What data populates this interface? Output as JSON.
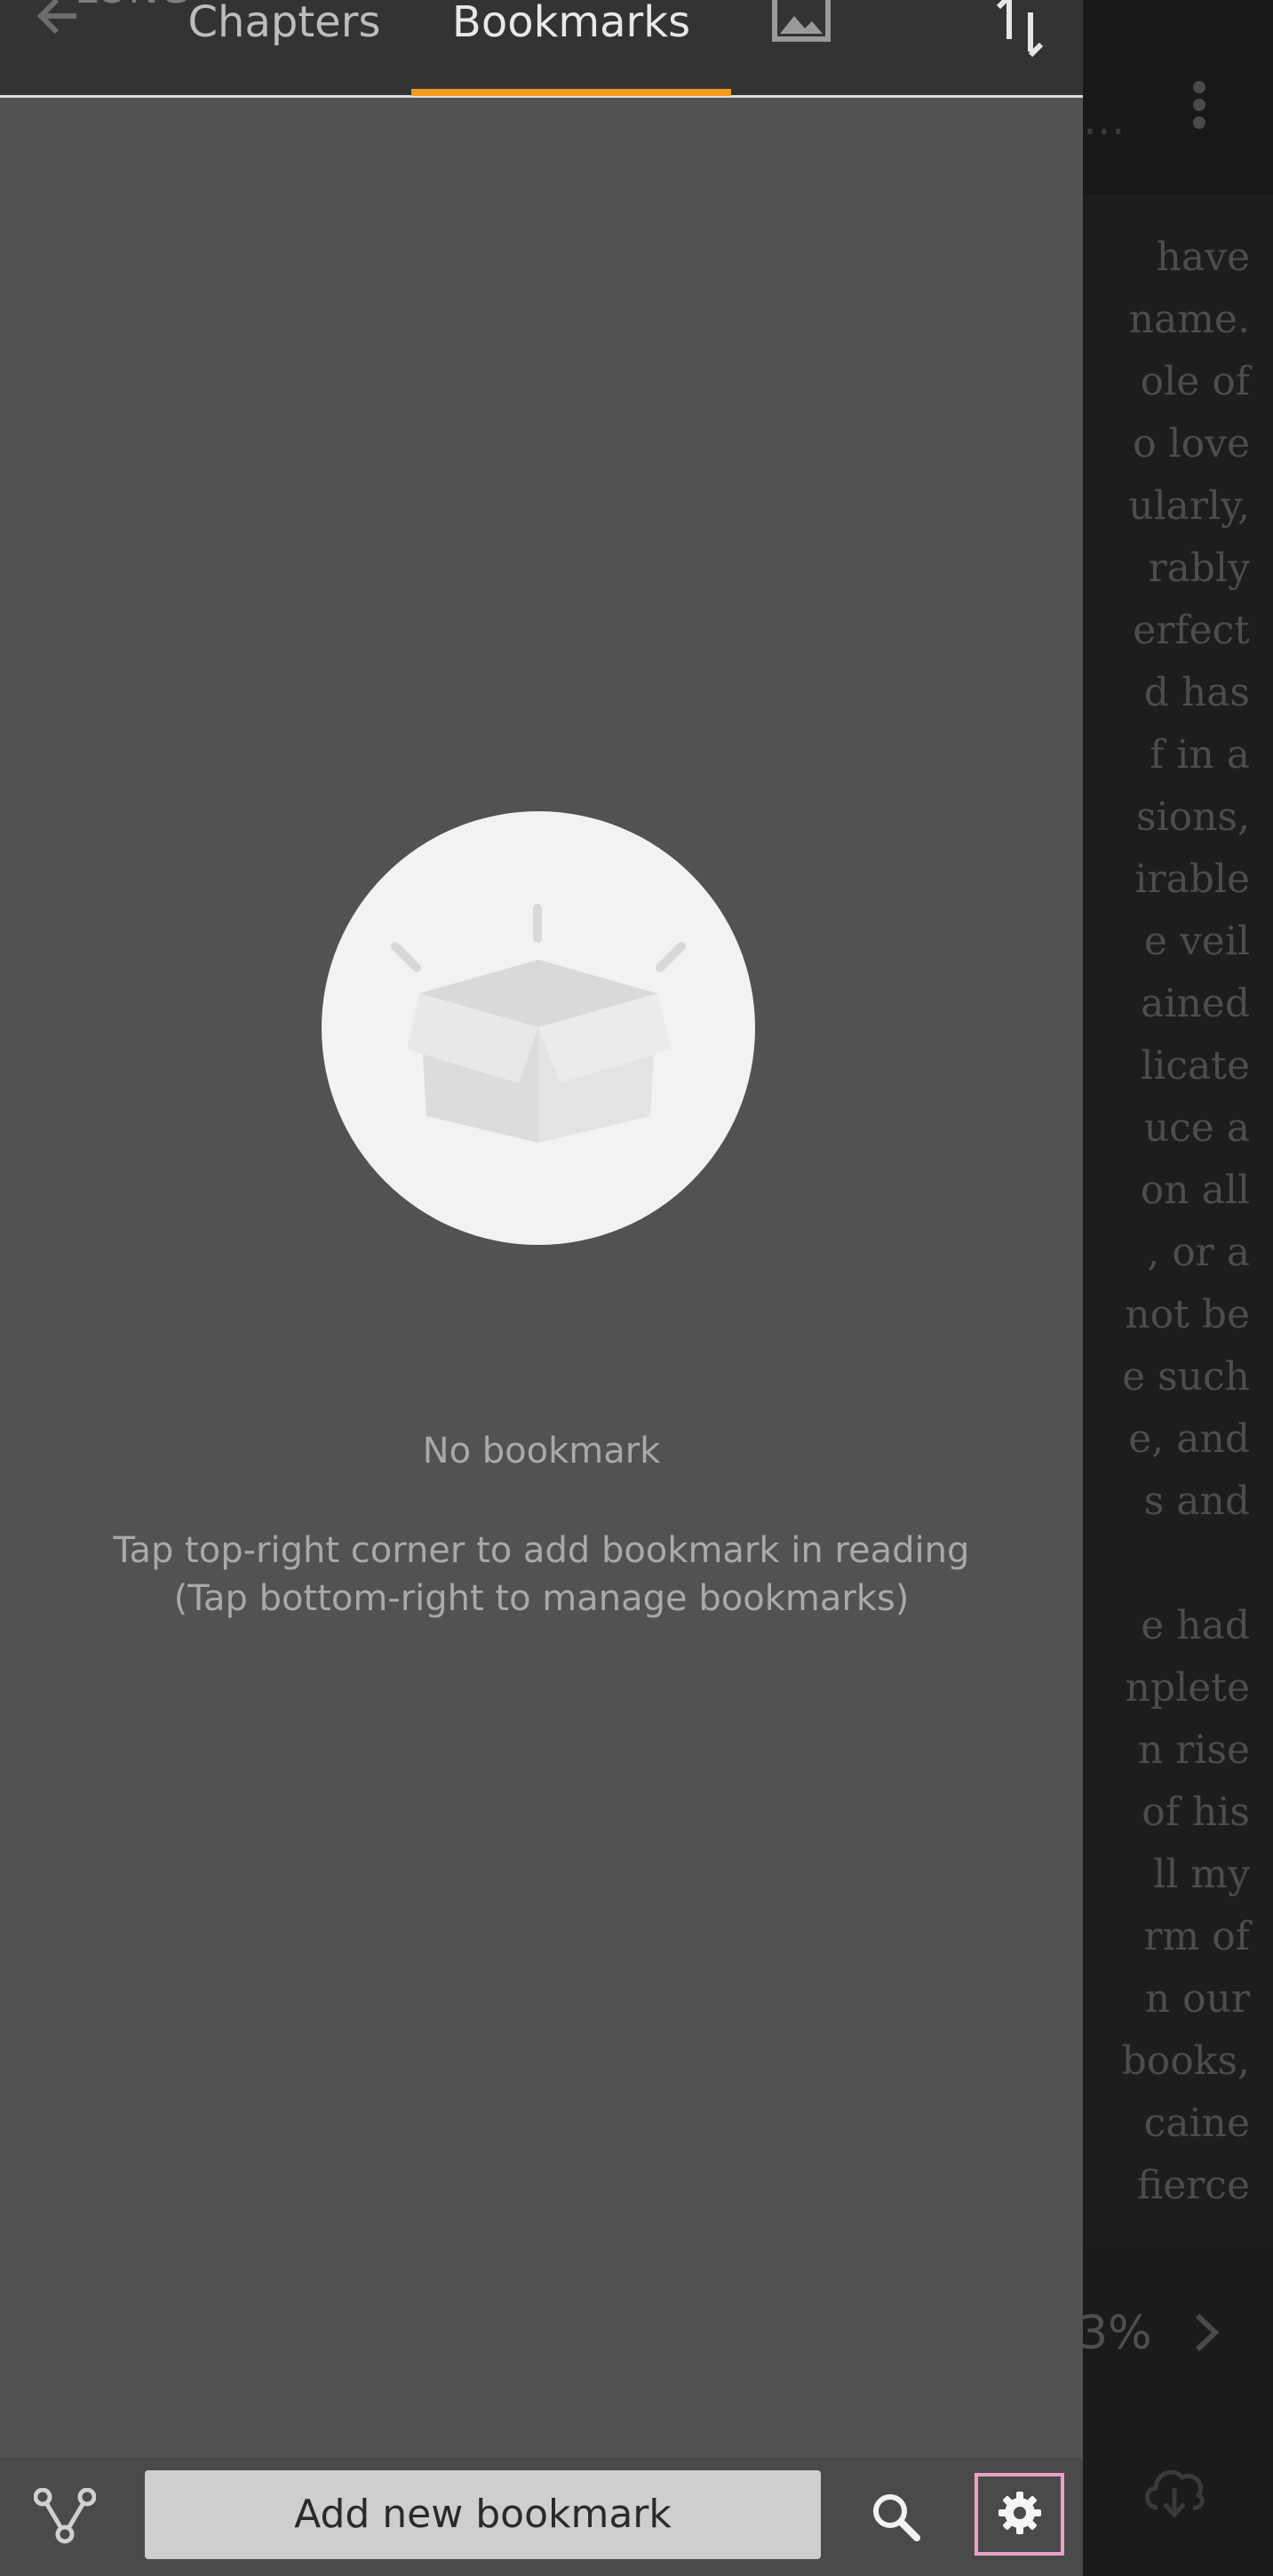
{
  "reader": {
    "toolbar_title": "...",
    "progress": "3%",
    "text_fragments": [
      "have",
      "name.",
      "ole of",
      "o love",
      "ularly,",
      "rably",
      "erfect",
      "d  has",
      "f  in  a",
      "sions,",
      "irable",
      "e  veil",
      "ained",
      "licate",
      "uce  a",
      "on  all",
      ",  or  a",
      "not  be",
      "e  such",
      "e,  and",
      "s  and",
      "",
      "e  had",
      "nplete",
      "n  rise",
      "of  his",
      "ll  my",
      "rm  of",
      "n  our",
      "books,",
      "caine",
      "fierce"
    ]
  },
  "drawer": {
    "header": {
      "partial_left": "LONG",
      "partial_right": "▲ ▼",
      "tabs": [
        {
          "id": "chapters",
          "label": "Chapters",
          "selected": false
        },
        {
          "id": "bookmarks",
          "label": "Bookmarks",
          "selected": true
        }
      ],
      "images_tab_icon": "image-icon",
      "sort_icon": "sort-icon",
      "accent_color": "#f39a21"
    },
    "empty_state": {
      "icon": "open-box-icon",
      "title": "No bookmark",
      "hint_line1": "Tap top-right corner to add bookmark in reading",
      "hint_line2": "(Tap bottom-right to manage bookmarks)"
    },
    "bottom_bar": {
      "share_icon": "share-icon",
      "add_button_label": "Add new bookmark",
      "search_icon": "search-icon",
      "settings_icon": "gear-icon",
      "settings_highlight_color": "#e9a2c6"
    }
  }
}
